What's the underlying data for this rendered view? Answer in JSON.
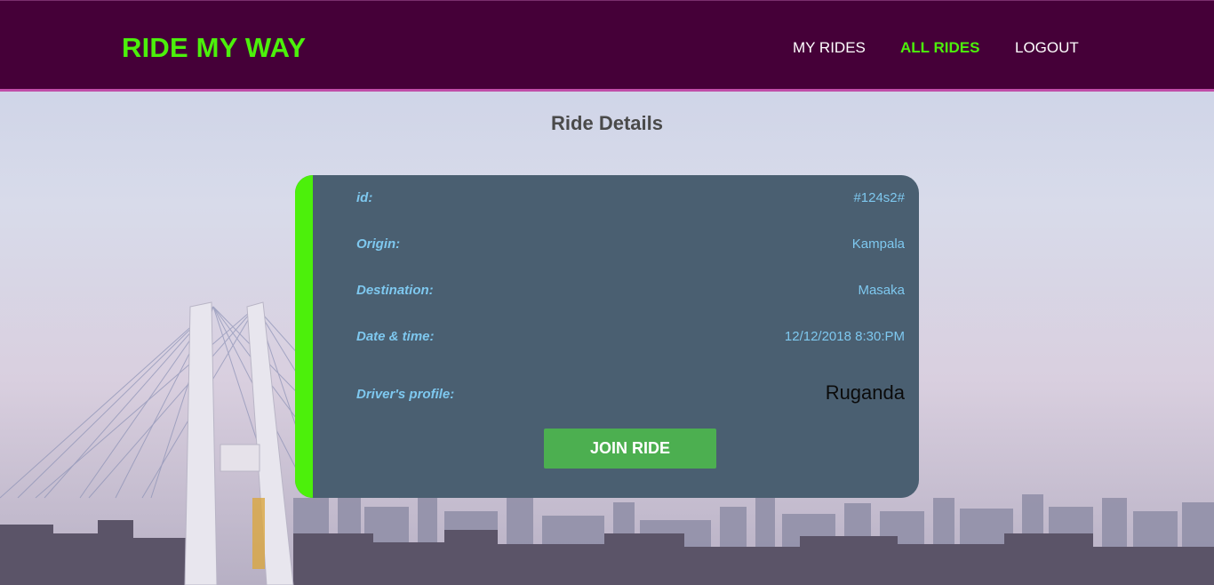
{
  "header": {
    "brand": "RIDE MY WAY",
    "nav": [
      {
        "label": "MY RIDES",
        "active": false
      },
      {
        "label": "ALL RIDES",
        "active": true
      },
      {
        "label": "LOGOUT",
        "active": false
      }
    ]
  },
  "page": {
    "title": "Ride Details"
  },
  "ride": {
    "fields": [
      {
        "label": "id:",
        "value": "#124s2#"
      },
      {
        "label": "Origin:",
        "value": "Kampala"
      },
      {
        "label": "Destination:",
        "value": "Masaka"
      },
      {
        "label": "Date & time:",
        "value": "12/12/2018 8:30:PM"
      },
      {
        "label": "Driver's profile:",
        "value": "Ruganda"
      }
    ],
    "join_label": "JOIN RIDE"
  },
  "colors": {
    "header_bg": "#450038",
    "brand": "#4cf00b",
    "card_bg": "#4a5f71",
    "card_accent": "#4cf00b",
    "field_text": "#7ec8ef",
    "button_bg": "#4caf50"
  }
}
